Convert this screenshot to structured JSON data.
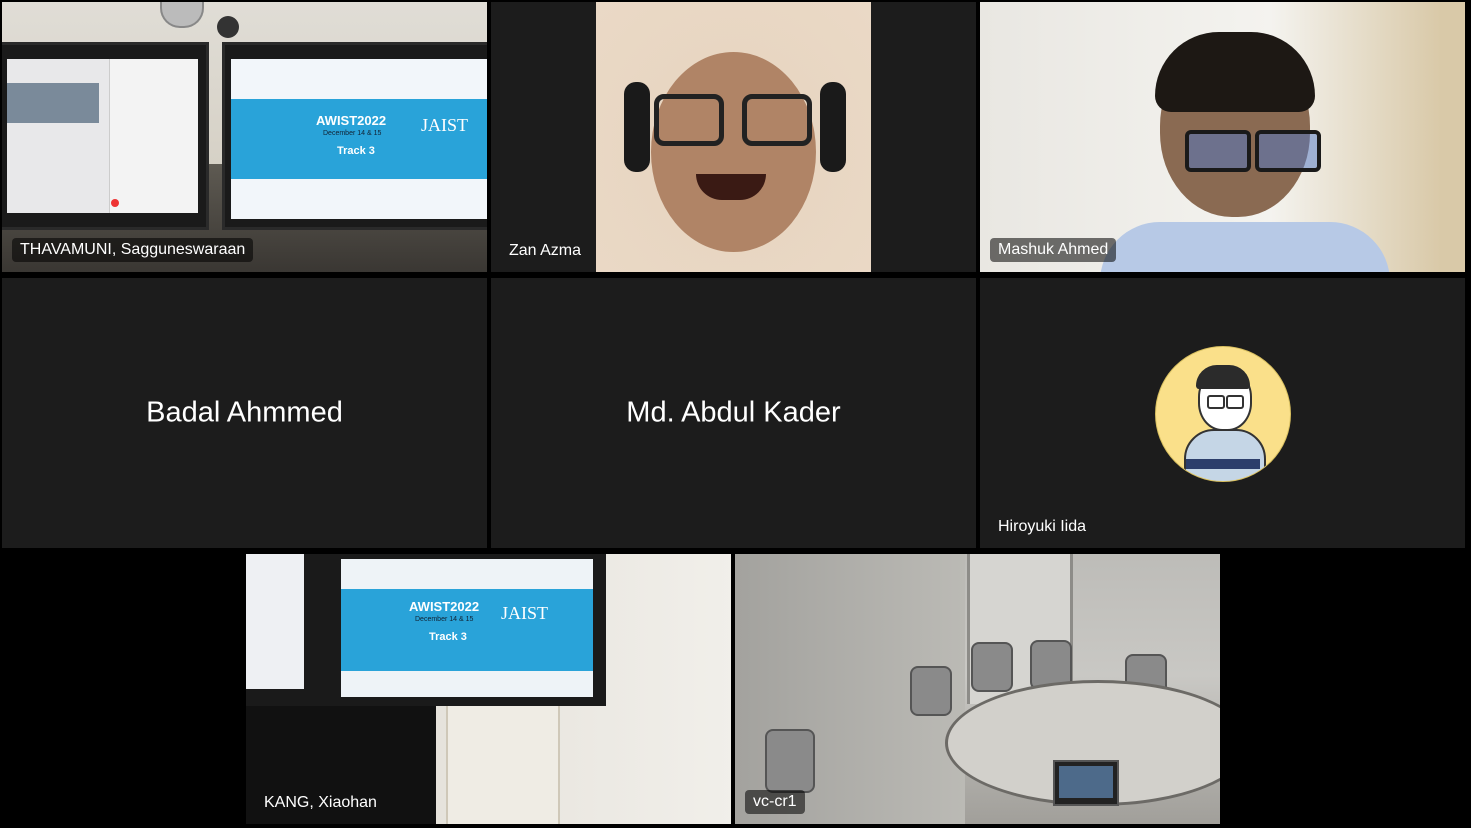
{
  "participants": [
    {
      "name": "THAVAMUNI, Sagguneswaraan",
      "video": true
    },
    {
      "name": "Zan Azma",
      "video": true
    },
    {
      "name": "Mashuk Ahmed",
      "video": true
    },
    {
      "name": "Badal Ahmmed",
      "video": false
    },
    {
      "name": "Md. Abdul Kader",
      "video": false
    },
    {
      "name": "Hiroyuki Iida",
      "video": false,
      "avatar": "cartoon-avatar"
    },
    {
      "name": "KANG, Xiaohan",
      "video": true
    },
    {
      "name": "vc-cr1",
      "video": true
    }
  ],
  "slide": {
    "title": "AWIST2022",
    "subtitle": "December 14 & 15",
    "track": "Track 3",
    "logo": "JAIST"
  },
  "colors": {
    "background": "#000000",
    "tile": "#1c1c1c",
    "slide_blue": "#29a3d9"
  }
}
